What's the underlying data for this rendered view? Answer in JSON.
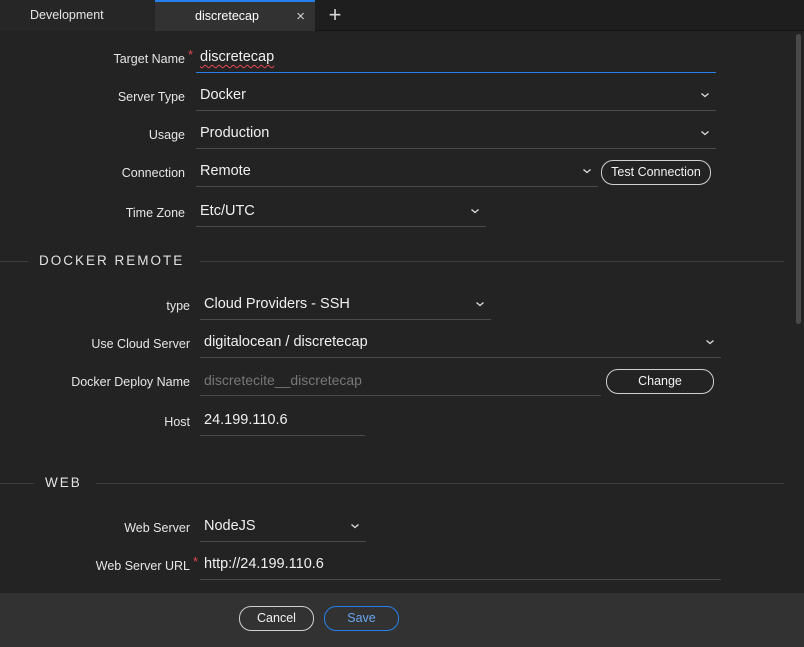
{
  "tabs": {
    "development": "Development",
    "active": "discretecap",
    "close": "×",
    "add": "+"
  },
  "form": {
    "target_name": {
      "label": "Target Name",
      "required": "*",
      "value": "discretecap"
    },
    "server_type": {
      "label": "Server Type",
      "value": "Docker"
    },
    "usage": {
      "label": "Usage",
      "value": "Production"
    },
    "connection": {
      "label": "Connection",
      "value": "Remote"
    },
    "test_connection": "Test Connection",
    "time_zone": {
      "label": "Time Zone",
      "value": "Etc/UTC"
    }
  },
  "docker_remote": {
    "title": "DOCKER REMOTE",
    "type": {
      "label": "type",
      "value": "Cloud Providers - SSH"
    },
    "cloud_server": {
      "label": "Use Cloud Server",
      "value": "digitalocean / discretecap"
    },
    "deploy_name": {
      "label": "Docker Deploy Name",
      "placeholder": "discretecite__discretecap"
    },
    "change": "Change",
    "host": {
      "label": "Host",
      "value": "24.199.110.6"
    }
  },
  "web": {
    "title": "WEB",
    "web_server": {
      "label": "Web Server",
      "value": "NodeJS"
    },
    "web_server_url": {
      "label": "Web Server URL",
      "required": "*",
      "value": "http://24.199.110.6"
    }
  },
  "footer": {
    "cancel": "Cancel",
    "save": "Save"
  },
  "icons": [
    "close-icon",
    "plus-icon",
    "chevron-down-icon"
  ],
  "colors": {
    "accent": "#2680eb",
    "required": "#e34850",
    "background": "#232323"
  }
}
